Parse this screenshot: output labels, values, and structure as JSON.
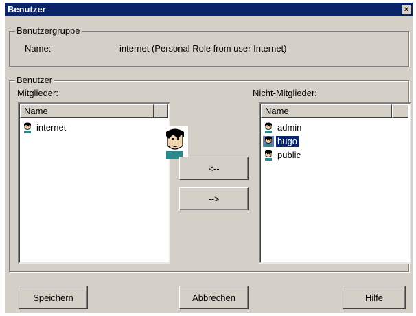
{
  "window": {
    "title": "Benutzer",
    "close_glyph": "×"
  },
  "group_box": {
    "legend": "Benutzergruppe",
    "name_label": "Name:",
    "name_value": "internet (Personal Role from user Internet)"
  },
  "users_box": {
    "legend": "Benutzer",
    "members_label": "Mitglieder:",
    "nonmembers_label": "Nicht-Mitglieder:",
    "column_header": "Name",
    "members": [
      {
        "name": "internet",
        "icon": "user-icon"
      }
    ],
    "nonmembers": [
      {
        "name": "admin",
        "icon": "user-icon"
      },
      {
        "name": "hugo",
        "icon": "user-icon",
        "selected": true
      },
      {
        "name": "public",
        "icon": "user-icon"
      }
    ]
  },
  "transfer_buttons": {
    "add": "<--",
    "remove": "-->"
  },
  "footer_buttons": {
    "save": "Speichern",
    "cancel": "Abbrechen",
    "help": "Hilfe"
  },
  "colors": {
    "title_bar": "#0a246a",
    "dialog_bg": "#d4d0c8",
    "selection": "#0a246a"
  },
  "drag_icon": "user-drag-icon"
}
